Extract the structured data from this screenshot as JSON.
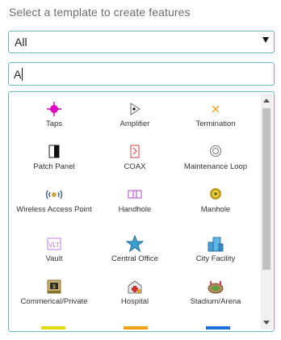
{
  "heading": "Select a template to create features",
  "layer_filter": {
    "selected": "All"
  },
  "search": {
    "value": "A"
  },
  "templates": [
    {
      "label": "Taps",
      "icon": "taps-icon"
    },
    {
      "label": "Amplifier",
      "icon": "amplifier-icon"
    },
    {
      "label": "Termination",
      "icon": "termination-icon"
    },
    {
      "label": "Patch Panel",
      "icon": "patch-panel-icon"
    },
    {
      "label": "COAX",
      "icon": "coax-icon"
    },
    {
      "label": "Maintenance Loop",
      "icon": "maintenance-loop-icon"
    },
    {
      "label": "Wireless Access Point",
      "icon": "wireless-access-point-icon"
    },
    {
      "label": "Handhole",
      "icon": "handhole-icon"
    },
    {
      "label": "Manhole",
      "icon": "manhole-icon"
    },
    {
      "label": "Vault",
      "icon": "vault-icon"
    },
    {
      "label": "Central Office",
      "icon": "central-office-icon"
    },
    {
      "label": "City Facility",
      "icon": "city-facility-icon"
    },
    {
      "label": "Commerical/Private",
      "icon": "commercial-private-icon"
    },
    {
      "label": "Hospital",
      "icon": "hospital-icon"
    },
    {
      "label": "Stadium/Arena",
      "icon": "stadium-arena-icon"
    }
  ],
  "line_swatches": [
    {
      "color": "#e0dc10"
    },
    {
      "color": "#f0a010"
    },
    {
      "color": "#1a6fd8"
    }
  ]
}
